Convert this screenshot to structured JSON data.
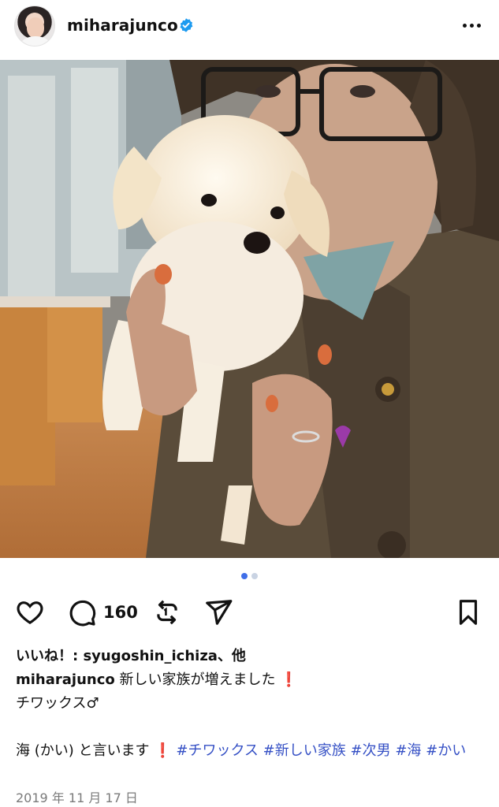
{
  "header": {
    "username": "miharajunco",
    "verified": true
  },
  "post": {
    "carousel": {
      "count": 2,
      "active_index": 0,
      "active_color": "#3f6ee8",
      "inactive_color": "#c9d3e3"
    },
    "comment_count": "160",
    "likes_text": "いいね！: syugoshin_ichiza、他",
    "caption": {
      "username": "miharajunco",
      "line1": "新しい家族が増えました",
      "line2": "チワックス♂",
      "line3_text": "海 (かい) と言います",
      "hashtags": [
        "#チワックス",
        "#新しい家族",
        "#次男",
        "#海",
        "#かい"
      ]
    },
    "date": "2019 年 11 月 17 日"
  },
  "colors": {
    "accent": "#3550c5",
    "verified": "#1d9bf0",
    "date_gray": "#7a7a7a"
  },
  "icons": [
    "heart-icon",
    "comment-icon",
    "repost-icon",
    "share-icon",
    "bookmark-icon",
    "more-icon",
    "verified-badge-icon",
    "exclamation-emoji"
  ]
}
